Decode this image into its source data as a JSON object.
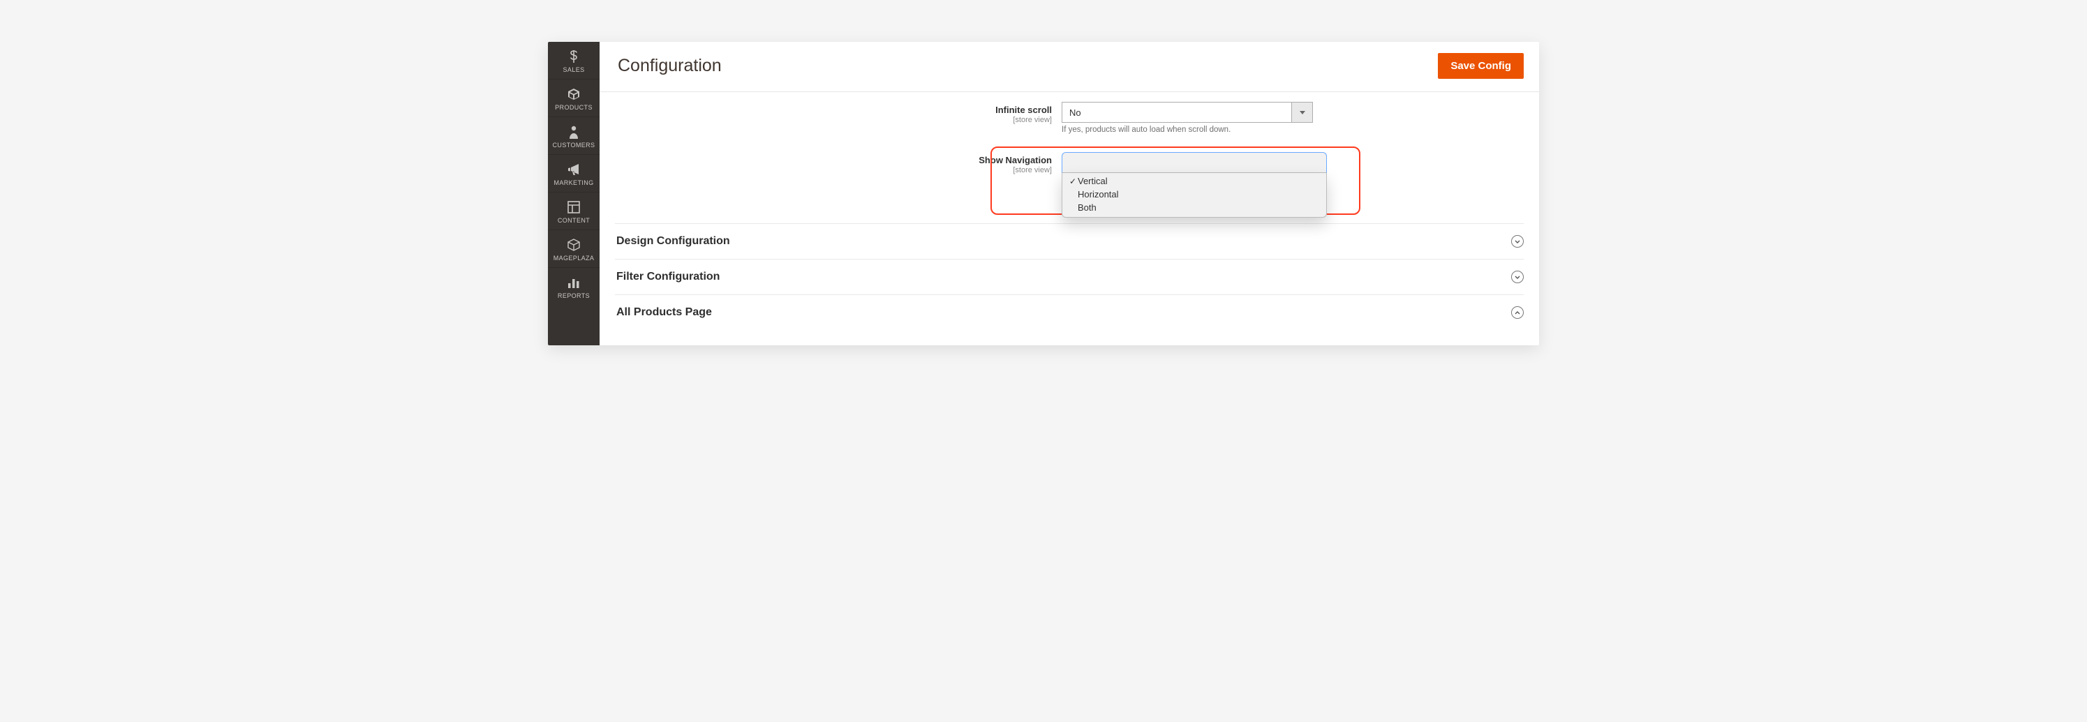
{
  "header": {
    "title": "Configuration",
    "save_label": "Save Config"
  },
  "sidebar": {
    "items": [
      {
        "label": "SALES"
      },
      {
        "label": "PRODUCTS"
      },
      {
        "label": "CUSTOMERS"
      },
      {
        "label": "MARKETING"
      },
      {
        "label": "CONTENT"
      },
      {
        "label": "MAGEPLAZA"
      },
      {
        "label": "REPORTS"
      }
    ]
  },
  "fields": {
    "infinite_scroll": {
      "label": "Infinite scroll",
      "scope": "[store view]",
      "value": "No",
      "note": "If yes, products will auto load when scroll down."
    },
    "show_navigation": {
      "label": "Show Navigation",
      "scope": "[store view]",
      "options": [
        {
          "label": "Vertical",
          "selected": true
        },
        {
          "label": "Horizontal",
          "selected": false
        },
        {
          "label": "Both",
          "selected": false
        }
      ]
    }
  },
  "sections": [
    {
      "title": "Design Configuration",
      "expanded": false
    },
    {
      "title": "Filter Configuration",
      "expanded": false
    },
    {
      "title": "All Products Page",
      "expanded": true
    }
  ]
}
